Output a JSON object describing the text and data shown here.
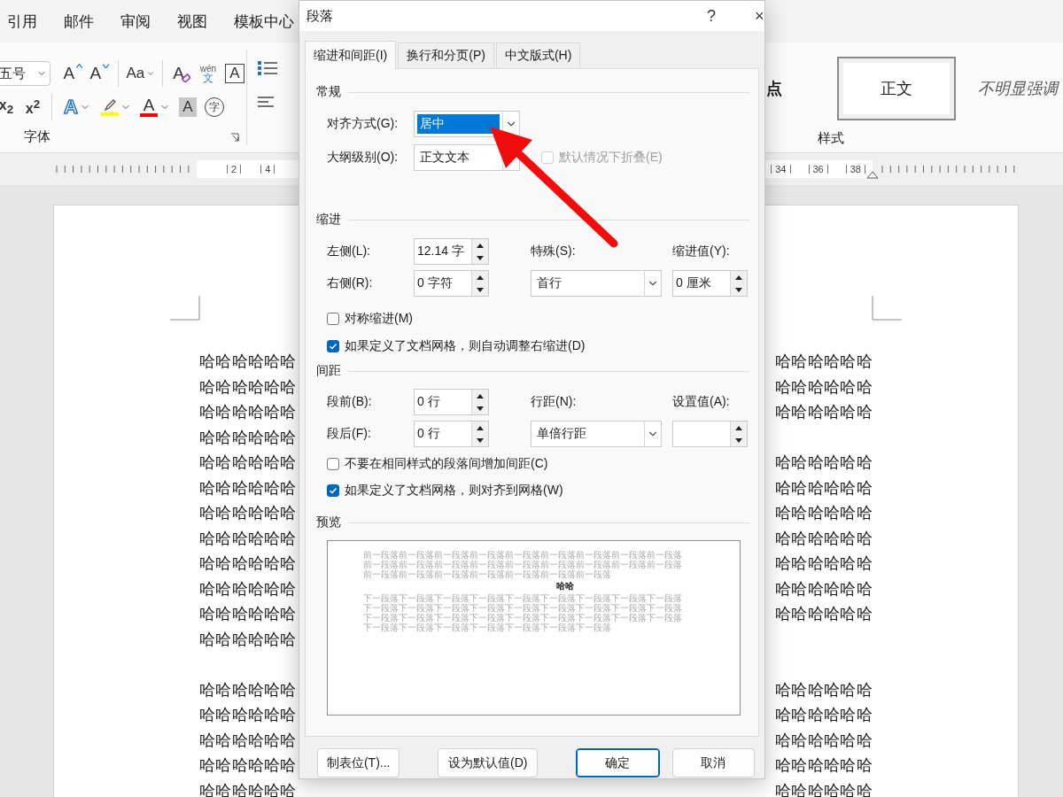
{
  "ribbon_tabs": [
    {
      "label": "引用"
    },
    {
      "label": "邮件"
    },
    {
      "label": "审阅"
    },
    {
      "label": "视图"
    },
    {
      "label": "模板中心"
    }
  ],
  "font_group": {
    "label": "字体",
    "size": "五号",
    "row1": [
      {
        "kind": "grow",
        "glyph": "A"
      },
      {
        "kind": "shrink",
        "glyph": "A"
      },
      {
        "kind": "case",
        "glyph": "Aa"
      },
      {
        "kind": "clear",
        "glyph": "A"
      },
      {
        "kind": "pinyin",
        "top": "wén",
        "glyph": "文"
      },
      {
        "kind": "border",
        "glyph": "A"
      }
    ],
    "row2": [
      {
        "kind": "sub",
        "glyph": "x$_{2}$"
      },
      {
        "kind": "sup",
        "glyph": "x$^{2}$"
      },
      {
        "kind": "effects",
        "glyph": "A"
      },
      {
        "kind": "highlight",
        "color": "#ffff00"
      },
      {
        "kind": "color",
        "glyph": "A",
        "color": "#ff0000"
      },
      {
        "kind": "shading",
        "glyph": "A"
      },
      {
        "kind": "enclose",
        "glyph": "字"
      }
    ]
  },
  "styles_group": {
    "label": "样式",
    "items": [
      {
        "label": "点",
        "kind": "heading",
        "selected": false
      },
      {
        "label": "正文",
        "kind": "normal",
        "selected": true
      },
      {
        "label": "不明显强调",
        "kind": "subtle",
        "selected": false
      }
    ]
  },
  "ruler": {
    "left_numbers": [
      "2",
      "4"
    ],
    "right_numbers": [
      "34",
      "36",
      "38"
    ]
  },
  "document": {
    "paragraphs": [
      {
        "lines": [
          {
            "left": "哈哈哈哈哈哈",
            "right": "哈哈哈哈哈哈"
          },
          {
            "left": "哈哈哈哈哈哈",
            "right": "哈哈哈哈哈哈"
          },
          {
            "left": "哈哈哈哈哈哈",
            "right": "哈哈哈哈哈哈"
          },
          {
            "left": "哈哈哈哈哈哈"
          },
          {
            "left": "哈哈哈哈哈哈",
            "right": "哈哈哈哈哈哈"
          },
          {
            "left": "哈哈哈哈哈哈",
            "right": "哈哈哈哈哈哈"
          },
          {
            "left": "哈哈哈哈哈哈",
            "right": "哈哈哈哈哈哈"
          },
          {
            "left": "哈哈哈哈哈哈",
            "right": "哈哈哈哈哈哈"
          },
          {
            "left": "哈哈哈哈哈哈",
            "right": "哈哈哈哈哈哈"
          },
          {
            "left": "哈哈哈哈哈哈",
            "right": "哈哈哈哈哈哈"
          },
          {
            "left": "哈哈哈哈哈哈",
            "right": "哈哈哈哈哈哈"
          },
          {
            "left": "哈哈哈哈哈哈"
          }
        ]
      },
      {
        "lines": [
          {
            "left": "哈哈哈哈哈哈",
            "right": "哈哈哈哈哈哈"
          },
          {
            "left": "哈哈哈哈哈哈",
            "right": "哈哈哈哈哈哈"
          },
          {
            "left": "哈哈哈哈哈哈",
            "right": "哈哈哈哈哈哈"
          },
          {
            "left": "哈哈哈哈哈哈",
            "right": "哈哈哈哈哈哈"
          },
          {
            "left": "哈哈哈哈哈哈",
            "right": "哈哈哈哈哈哈"
          }
        ]
      }
    ]
  },
  "dialog": {
    "title": "段落",
    "help": "?",
    "close": "×",
    "tabs": [
      {
        "label": "缩进和间距(I)",
        "selected": true
      },
      {
        "label": "换行和分页(P)",
        "selected": false
      },
      {
        "label": "中文版式(H)",
        "selected": false
      }
    ],
    "general": {
      "title": "常规",
      "alignment": {
        "label": "对齐方式(G):",
        "value": "居中",
        "focused": true
      },
      "outline": {
        "label": "大纲级别(O):",
        "value": "正文文本",
        "focused": false
      },
      "collapse": {
        "label": "默认情况下折叠(E)",
        "checked": false,
        "disabled": true
      }
    },
    "indent": {
      "title": "缩进",
      "left": {
        "label": "左侧(L):",
        "value": "12.14 字"
      },
      "right": {
        "label": "右侧(R):",
        "value": "0 字符"
      },
      "special": {
        "label": "特殊(S):",
        "value": "首行"
      },
      "by": {
        "label": "缩进值(Y):",
        "value": "0 厘米"
      },
      "checks": [
        {
          "label": "对称缩进(M)",
          "checked": false
        },
        {
          "label": "如果定义了文档网格，则自动调整右缩进(D)",
          "checked": true
        }
      ]
    },
    "spacing": {
      "title": "间距",
      "before": {
        "label": "段前(B):",
        "value": "0 行"
      },
      "after": {
        "label": "段后(F):",
        "value": "0 行"
      },
      "line": {
        "label": "行距(N):",
        "value": "单倍行距"
      },
      "at": {
        "label": "设置值(A):"
      },
      "checks": [
        {
          "label": "不要在相同样式的段落间增加间距(C)",
          "checked": false
        },
        {
          "label": "如果定义了文档网格，则对齐到网格(W)",
          "checked": true
        }
      ]
    },
    "preview": {
      "title": "预览",
      "before": "前一段落前一段落前一段落前一段落前一段落前一段落前一段落前一段落前一段落前一段落前一段落前一段落前一段落前一段落前一段落前一段落前一段落前一段落前一段落前一段落前一段落前一段落前一段落前一段落前一段落",
      "sample": "哈哈",
      "after": "下一段落下一段落下一段落下一段落下一段落下一段落下一段落下一段落下一段落下一段落下一段落下一段落下一段落下一段落下一段落下一段落下一段落下一段落下一段落下一段落下一段落下一段落下一段落下一段落下一段落下一段落下一段落下一段落下一段落下一段落下一段落下一段落下一段落下一段落"
    },
    "buttons": [
      {
        "label": "制表位(T)...",
        "default": false
      },
      {
        "label": "设为默认值(D)",
        "default": false
      },
      {
        "label": "确定",
        "default": true
      },
      {
        "label": "取消",
        "default": false
      }
    ]
  }
}
